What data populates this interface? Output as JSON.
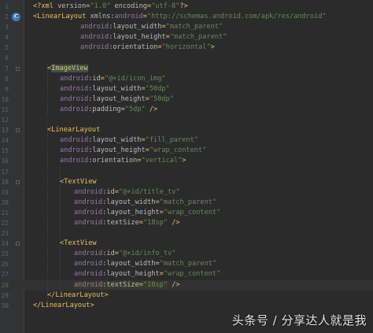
{
  "editor": {
    "lines": [
      {
        "n": "1",
        "parts": [
          [
            "punct",
            "<?"
          ],
          [
            "tag",
            "xml"
          ],
          [
            "attr",
            " version"
          ],
          [
            "punct",
            "="
          ],
          [
            "val",
            "\"1.0\""
          ],
          [
            "attr",
            " encoding"
          ],
          [
            "punct",
            "="
          ],
          [
            "val",
            "\"utf-8\""
          ],
          [
            "punct",
            "?>"
          ]
        ]
      },
      {
        "n": "2",
        "parts": [
          [
            "punct",
            "<"
          ],
          [
            "tag",
            "LinearLayout"
          ],
          [
            "attr",
            " xmlns:"
          ],
          [
            "ns",
            "android"
          ],
          [
            "punct",
            "="
          ],
          [
            "val",
            "\"http://schemas.android.com/apk/res/android\""
          ]
        ]
      },
      {
        "n": "3",
        "parts": [
          [
            "ns",
            "android"
          ],
          [
            "attr",
            ":layout_width"
          ],
          [
            "punct",
            "="
          ],
          [
            "val",
            "\"match_parent\""
          ]
        ]
      },
      {
        "n": "4",
        "parts": [
          [
            "ns",
            "android"
          ],
          [
            "attr",
            ":layout_height"
          ],
          [
            "punct",
            "="
          ],
          [
            "val",
            "\"match_parent\""
          ]
        ]
      },
      {
        "n": "5",
        "parts": [
          [
            "ns",
            "android"
          ],
          [
            "attr",
            ":orientation"
          ],
          [
            "punct",
            "="
          ],
          [
            "val",
            "\"horizontal\""
          ],
          [
            "punct",
            ">"
          ]
        ]
      },
      {
        "n": "6",
        "parts": []
      },
      {
        "n": "7",
        "parts": [
          [
            "punct",
            "<"
          ],
          [
            "taghl",
            "ImageView"
          ]
        ]
      },
      {
        "n": "8",
        "parts": [
          [
            "ns",
            "android"
          ],
          [
            "attr",
            ":id"
          ],
          [
            "punct",
            "="
          ],
          [
            "val",
            "\"@+id/icon_img\""
          ]
        ]
      },
      {
        "n": "9",
        "parts": [
          [
            "ns",
            "android"
          ],
          [
            "attr",
            ":layout_width"
          ],
          [
            "punct",
            "="
          ],
          [
            "val",
            "\"50dp\""
          ]
        ]
      },
      {
        "n": "10",
        "parts": [
          [
            "ns",
            "android"
          ],
          [
            "attr",
            ":layout_height"
          ],
          [
            "punct",
            "="
          ],
          [
            "val",
            "\"50dp\""
          ]
        ]
      },
      {
        "n": "11",
        "parts": [
          [
            "ns",
            "android"
          ],
          [
            "attr",
            ":padding"
          ],
          [
            "punct",
            "="
          ],
          [
            "val",
            "\"5dp\""
          ],
          [
            "punct",
            " />"
          ]
        ]
      },
      {
        "n": "12",
        "parts": []
      },
      {
        "n": "13",
        "parts": [
          [
            "punct",
            "<"
          ],
          [
            "tag",
            "LinearLayout"
          ]
        ]
      },
      {
        "n": "14",
        "parts": [
          [
            "ns",
            "android"
          ],
          [
            "attr",
            ":layout_width"
          ],
          [
            "punct",
            "="
          ],
          [
            "val",
            "\"fill_parent\""
          ]
        ]
      },
      {
        "n": "15",
        "parts": [
          [
            "ns",
            "android"
          ],
          [
            "attr",
            ":layout_height"
          ],
          [
            "punct",
            "="
          ],
          [
            "val",
            "\"wrap_content\""
          ]
        ]
      },
      {
        "n": "16",
        "parts": [
          [
            "ns",
            "android"
          ],
          [
            "attr",
            ":orientation"
          ],
          [
            "punct",
            "="
          ],
          [
            "val",
            "\"vertical\""
          ],
          [
            "punct",
            ">"
          ]
        ]
      },
      {
        "n": "17",
        "parts": []
      },
      {
        "n": "18",
        "parts": [
          [
            "punct",
            "<"
          ],
          [
            "tag",
            "TextView"
          ]
        ]
      },
      {
        "n": "19",
        "parts": [
          [
            "ns",
            "android"
          ],
          [
            "attr",
            ":id"
          ],
          [
            "punct",
            "="
          ],
          [
            "val",
            "\"@+id/title_tv\""
          ]
        ]
      },
      {
        "n": "20",
        "parts": [
          [
            "ns",
            "android"
          ],
          [
            "attr",
            ":layout_width"
          ],
          [
            "punct",
            "="
          ],
          [
            "val",
            "\"match_parent\""
          ]
        ]
      },
      {
        "n": "21",
        "parts": [
          [
            "ns",
            "android"
          ],
          [
            "attr",
            ":layout_height"
          ],
          [
            "punct",
            "="
          ],
          [
            "val",
            "\"wrap_content\""
          ]
        ]
      },
      {
        "n": "22",
        "parts": [
          [
            "ns",
            "android"
          ],
          [
            "attr",
            ":textSize"
          ],
          [
            "punct",
            "="
          ],
          [
            "val",
            "\"18sp\""
          ],
          [
            "punct",
            " />"
          ]
        ]
      },
      {
        "n": "23",
        "parts": []
      },
      {
        "n": "24",
        "parts": [
          [
            "punct",
            "<"
          ],
          [
            "tag",
            "TextView"
          ]
        ]
      },
      {
        "n": "25",
        "parts": [
          [
            "ns",
            "android"
          ],
          [
            "attr",
            ":id"
          ],
          [
            "punct",
            "="
          ],
          [
            "val",
            "\"@+id/info_tv\""
          ]
        ]
      },
      {
        "n": "26",
        "parts": [
          [
            "ns",
            "android"
          ],
          [
            "attr",
            ":layout_width"
          ],
          [
            "punct",
            "="
          ],
          [
            "val",
            "\"match_parent\""
          ]
        ]
      },
      {
        "n": "27",
        "parts": [
          [
            "ns",
            "android"
          ],
          [
            "attr",
            ":layout_height"
          ],
          [
            "punct",
            "="
          ],
          [
            "val",
            "\"wrap_content\""
          ]
        ]
      },
      {
        "n": "28",
        "parts": [
          [
            "nssel",
            "android"
          ],
          [
            "attrsel",
            ":textSize"
          ],
          [
            "punctsel",
            "="
          ],
          [
            "valsel",
            "\"10sp\""
          ],
          [
            "punct",
            " />"
          ]
        ]
      },
      {
        "n": "29",
        "parts": [
          [
            "punct",
            "</"
          ],
          [
            "tag",
            "LinearLayout"
          ],
          [
            "punct",
            ">"
          ]
        ]
      },
      {
        "n": "30",
        "parts": [
          [
            "punct",
            "</"
          ],
          [
            "tag",
            "LinearLayout"
          ],
          [
            "punct",
            ">"
          ]
        ]
      }
    ]
  },
  "watermark": "头条号 / 分享达人就是我"
}
